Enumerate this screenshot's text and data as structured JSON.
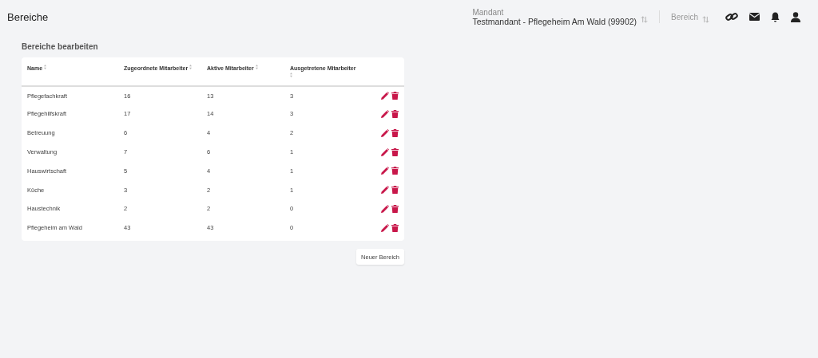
{
  "page_title": "Bereiche",
  "mandant": {
    "label": "Mandant",
    "value": "Testmandant - Pflegeheim Am Wald (99902)"
  },
  "bereich": {
    "label": "Bereich"
  },
  "section_title": "Bereiche bearbeiten",
  "table": {
    "columns": [
      "Name",
      "Zugeordnete Mitarbeiter",
      "Aktive Mitarbeiter",
      "Ausgetretene Mitarbeiter"
    ],
    "rows": [
      [
        "Pflegefachkraft",
        "16",
        "13",
        "3"
      ],
      [
        "Pflegehilfskraft",
        "17",
        "14",
        "3"
      ],
      [
        "Betreuung",
        "6",
        "4",
        "2"
      ],
      [
        "Verwaltung",
        "7",
        "6",
        "1"
      ],
      [
        "Hauswirtschaft",
        "5",
        "4",
        "1"
      ],
      [
        "Küche",
        "3",
        "2",
        "1"
      ],
      [
        "Haustechnik",
        "2",
        "2",
        "0"
      ],
      [
        "Pflegeheim am Wald",
        "43",
        "43",
        "0"
      ]
    ]
  },
  "new_button": "Neuer Bereich"
}
